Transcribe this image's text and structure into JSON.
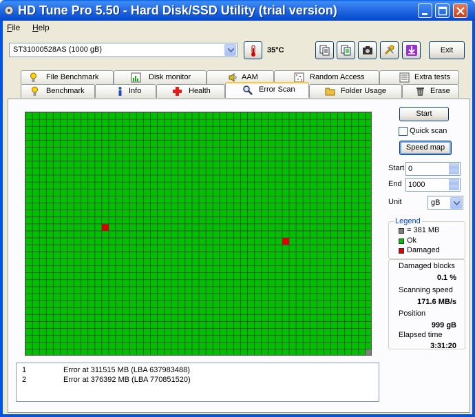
{
  "window": {
    "title": "HD Tune Pro 5.50 - Hard Disk/SSD Utility (trial version)"
  },
  "menu": {
    "items": [
      "File",
      "Help"
    ]
  },
  "toolbar": {
    "drive": "ST31000528AS (1000 gB)",
    "temperature": "35°C",
    "exit_label": "Exit"
  },
  "tabs": {
    "row1": [
      "File Benchmark",
      "Disk monitor",
      "AAM",
      "Random Access",
      "Extra tests"
    ],
    "row2": [
      "Benchmark",
      "Info",
      "Health",
      "Error Scan",
      "Folder Usage",
      "Erase"
    ],
    "active": "Error Scan"
  },
  "controls": {
    "start_button": "Start",
    "quick_scan_label": "Quick scan",
    "quick_scan_checked": false,
    "speed_map_button": "Speed map",
    "start_label": "Start",
    "start_value": "0",
    "end_label": "End",
    "end_value": "1000",
    "unit_label": "Unit",
    "unit_value": "gB"
  },
  "legend": {
    "title": "Legend",
    "items": [
      {
        "label": "= 381 MB",
        "color": "#808080"
      },
      {
        "label": "Ok",
        "color": "#00c000"
      },
      {
        "label": "Damaged",
        "color": "#e00000"
      }
    ]
  },
  "stats": {
    "damaged_blocks_label": "Damaged blocks",
    "damaged_blocks_value": "0.1 %",
    "scanning_speed_label": "Scanning speed",
    "scanning_speed_value": "171.6 MB/s",
    "position_label": "Position",
    "position_value": "999 gB",
    "elapsed_label": "Elapsed time",
    "elapsed_value": "3:31:20"
  },
  "log": [
    {
      "num": "1",
      "text": "Error at 311515 MB (LBA 637983488)"
    },
    {
      "num": "2",
      "text": "Error at 376392 MB (LBA 770851520)"
    }
  ],
  "scan_map": {
    "columns": 50,
    "rows": 35,
    "ok_color": "#00c000",
    "damaged_color": "#e00000",
    "unscanned_color": "#808080",
    "damaged_cells": [
      [
        16,
        11
      ],
      [
        18,
        37
      ]
    ],
    "unscanned_cells": [
      [
        34,
        49
      ]
    ]
  }
}
